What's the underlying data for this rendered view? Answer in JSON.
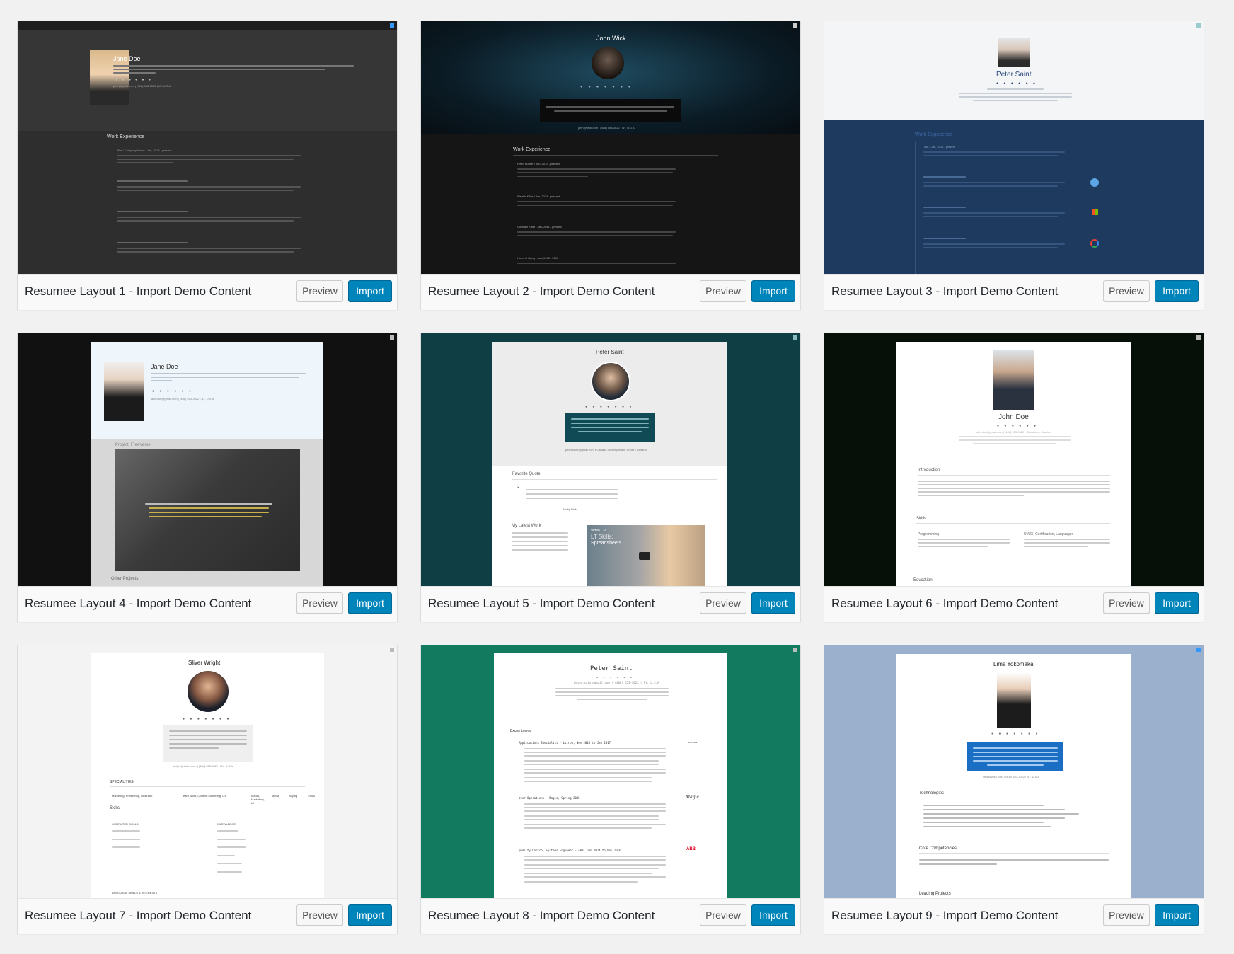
{
  "cards": [
    {
      "title": "Resumee Layout 1 - Import Demo Content",
      "preview_label": "Preview",
      "import_label": "Import",
      "shot": {
        "name": "Jane Doe",
        "contact": "jane@gmail.com | (408) 553-3022 | NY, U.S.A",
        "section": "Work Experience",
        "entry": "Title / Company Name / Jan, 2015 - present"
      }
    },
    {
      "title": "Resumee Layout 2 - Import Demo Content",
      "preview_label": "Preview",
      "import_label": "Import",
      "shot": {
        "name": "John Wick",
        "contact": "john@wick.com | (408) 553-3022 | NY, U.S.A",
        "section": "Work Experience",
        "entries": [
          "Hired Hunter / Jan, 2015 - present",
          "Stealth Killer / Jan, 2014 - present",
          "Contract Killer / Jan, 2011 - present",
          "Hired of Gang / Jan, 1992 - 2010"
        ]
      }
    },
    {
      "title": "Resumee Layout 3 - Import Demo Content",
      "preview_label": "Preview",
      "import_label": "Import",
      "shot": {
        "name": "Peter Saint",
        "section": "Work Experience",
        "entry": "Title / Jan, 2015 - present"
      }
    },
    {
      "title": "Resumee Layout 4 - Import Demo Content",
      "preview_label": "Preview",
      "import_label": "Import",
      "shot": {
        "name": "Jane Doe",
        "contact": "jane.doe@gmail.com | (408) 553-3022 | NY, U.S.A",
        "section": "Project: FreeVerse",
        "section2": "Other Projects"
      }
    },
    {
      "title": "Resumee Layout 5 - Import Demo Content",
      "preview_label": "Preview",
      "import_label": "Import",
      "shot": {
        "name": "Peter Saint",
        "contact": "peter.saint@gmail.com • Canada • Entrepreneur • Poet • Guitarist",
        "section": "Favorite Quote",
        "section2": "My Latest Work",
        "quote_author": "— Moby Dick",
        "video_line1": "Video CV",
        "video_line2": "LT Skills:",
        "video_line3": "Spreadsheets"
      }
    },
    {
      "title": "Resumee Layout 6 - Import Demo Content",
      "preview_label": "Preview",
      "import_label": "Import",
      "shot": {
        "name": "John Doe",
        "contact": "john.doe@gmail.com | (408) 553-3022 | Stockholm, Sweden",
        "section": "Introduction",
        "section2": "Skills",
        "section3": "Education",
        "sub1": "Programming",
        "sub2": "UI/UX, Certification, Languages"
      }
    },
    {
      "title": "Resumee Layout 7 - Import Demo Content",
      "preview_label": "Preview",
      "import_label": "Import",
      "shot": {
        "name": "Sliver Wright",
        "contact": "wright@sliver.com | (408) 553-3022 | NY, U.S.A",
        "section": "SPECIALITIES",
        "spec_items": [
          "Marketing, Photoshop, Illustrator",
          "Team Work, Content Marketing, UX",
          "Media, Marketing, UI",
          "Media",
          "Buying",
          "Email"
        ],
        "section2": "Skills",
        "col1": "COMPUTER SKILLS",
        "col2": "KNOWLEDGE",
        "section3": "LANGUAGE SKILLS & INTERESTS"
      }
    },
    {
      "title": "Resumee Layout 8 - Import Demo Content",
      "preview_label": "Preview",
      "import_label": "Import",
      "shot": {
        "name": "Peter Saint",
        "contact": "peter.saint@gmail.com | (408) 553-3022 | NY, U.S.A",
        "section": "Experience",
        "entries": [
          "Applications Specialist - Lutron, Nov 2016 to Jan 2017",
          "User Operations - Magic, Spring 2015",
          "Quality Control Systems Engineer - ABB, Jan 2014 to Nov 2016"
        ],
        "logos": [
          "LUTRON",
          "Magic",
          "ABB"
        ]
      }
    },
    {
      "title": "Resumee Layout 9 - Import Demo Content",
      "preview_label": "Preview",
      "import_label": "Import",
      "shot": {
        "name": "Lima Yokomaka",
        "contact": "lima@yoko.com | (408) 553-3022 | NY, U.S.A",
        "section": "Technologies",
        "section2": "Core Competencies",
        "section3": "Leading Projects"
      }
    }
  ],
  "colors": {
    "import_button": "#0085ba",
    "page_bg": "#f1f1f1"
  }
}
